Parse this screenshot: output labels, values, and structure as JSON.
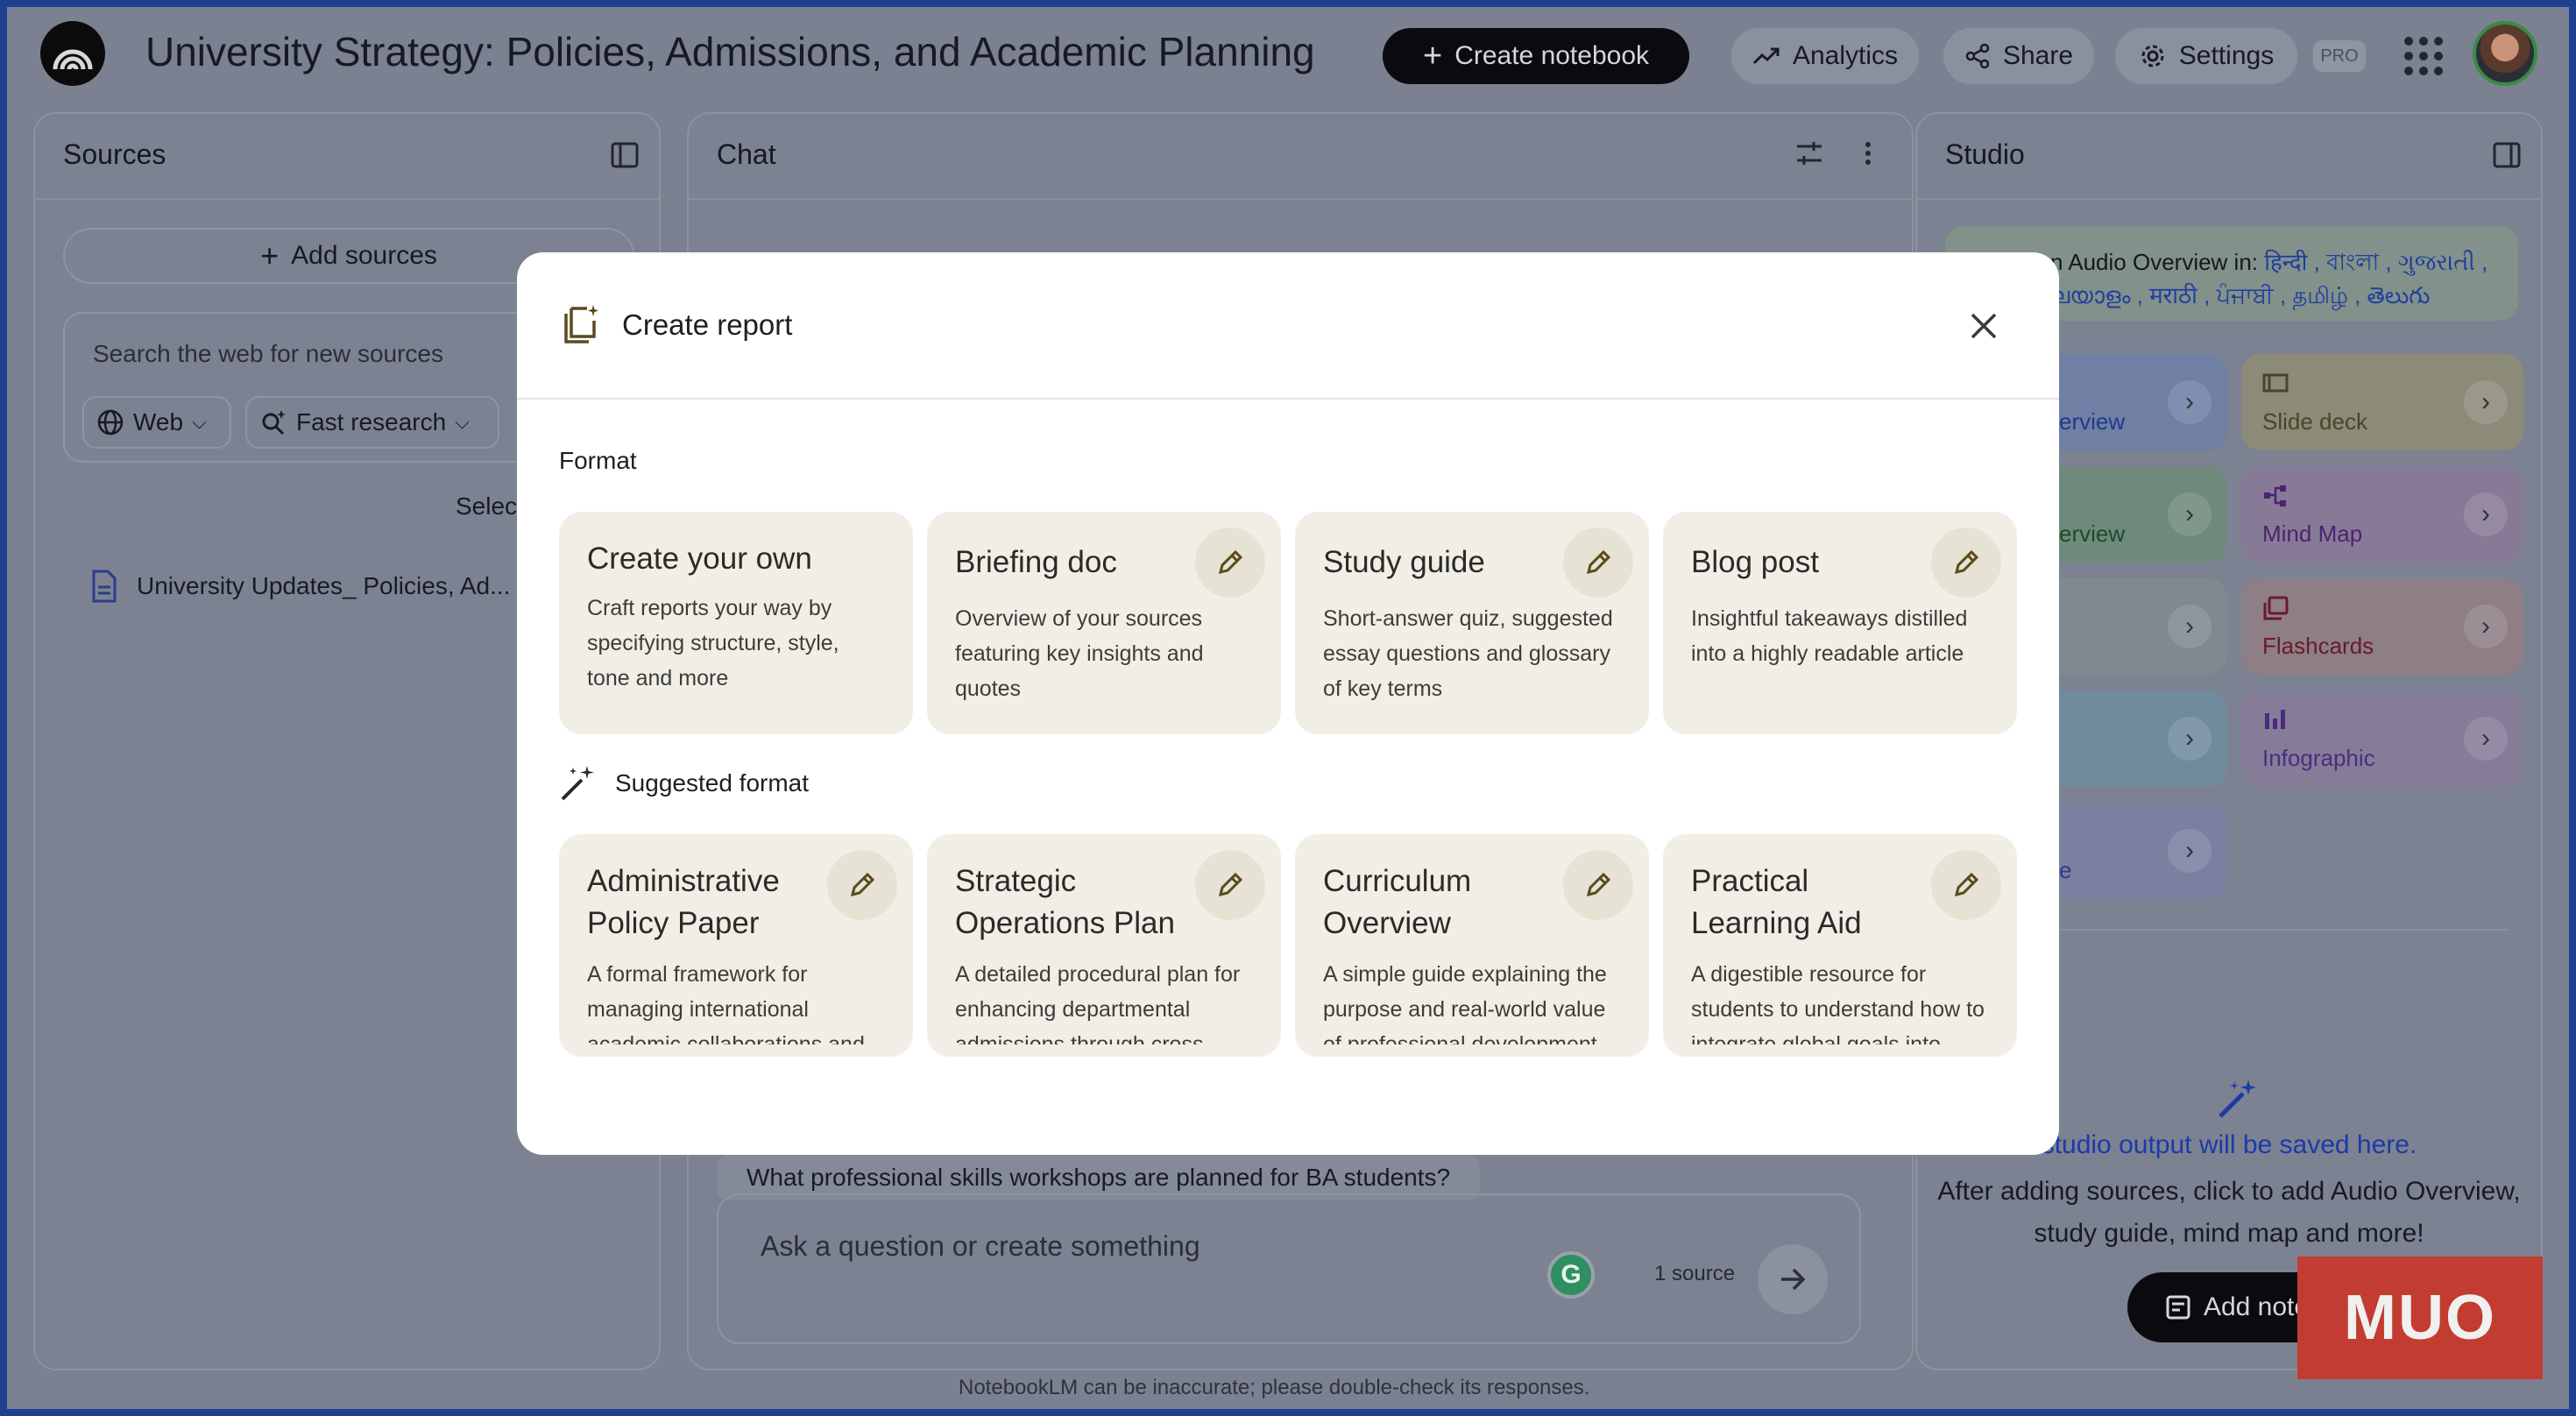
{
  "app": {
    "title": "University Strategy: Policies, Admissions, and Academic Planning",
    "create_notebook": "Create notebook",
    "analytics": "Analytics",
    "share": "Share",
    "settings": "Settings",
    "pro_badge": "PRO"
  },
  "sources": {
    "title": "Sources",
    "add_sources": "Add sources",
    "search_placeholder": "Search the web for new sources",
    "chip_web": "Web",
    "chip_research": "Fast research",
    "select_all": "Select",
    "items": [
      {
        "label": "University Updates_ Policies, Ad..."
      }
    ]
  },
  "chat": {
    "title": "Chat",
    "suggestion": "What professional skills workshops are planned for BA students?",
    "input_placeholder": "Ask a question or create something",
    "source_count": "1 source",
    "disclaimer": "NotebookLM can be inaccurate; please double-check its responses."
  },
  "studio": {
    "title": "Studio",
    "banner_prefix": "n Audio Overview in: ",
    "banner_langs_1": "हिन्दी , বাংলা , ગુજરાતી ,",
    "banner_langs_2": "ലയാളം , मराठी , ਪੰਜਾਬੀ , தமிழ் , తెలుగు",
    "tiles": [
      {
        "label": "erview",
        "color": "#6f80a4",
        "text_color": "#1f3a8c"
      },
      {
        "label": "Slide deck",
        "color": "#8c8a78",
        "text_color": "#4a4526"
      },
      {
        "label": "erview",
        "color": "#6f8a7c",
        "text_color": "#1d4a2a"
      },
      {
        "label": "Mind Map",
        "color": "#877a96",
        "text_color": "#4d2370"
      },
      {
        "label": "",
        "color": "#7e8a90",
        "text_color": "#1d2c46"
      },
      {
        "label": "Flashcards",
        "color": "#8e7f86",
        "text_color": "#6a1a2a"
      },
      {
        "label": "",
        "color": "#708b9c",
        "text_color": "#1d3a5c"
      },
      {
        "label": "Infographic",
        "color": "#857d98",
        "text_color": "#4a2c80"
      },
      {
        "label": "e",
        "color": "#7c80a0",
        "text_color": "#2c3a8e"
      }
    ],
    "saved_text": "studio output will be saved here.",
    "help_line_1": "After adding sources, click to add Audio Overview,",
    "help_line_2": "study guide, mind map and more!",
    "add_note": "Add note"
  },
  "watermark": "MUO",
  "modal": {
    "title": "Create report",
    "format_label": "Format",
    "suggested_label": "Suggested format",
    "formats": [
      {
        "title": "Create your own",
        "desc": "Craft reports your way by specifying structure, style, tone and more",
        "editable": false
      },
      {
        "title": "Briefing doc",
        "desc": "Overview of your sources featuring key insights and quotes",
        "editable": true
      },
      {
        "title": "Study guide",
        "desc": "Short-answer quiz, suggested essay questions and glossary of key terms",
        "editable": true
      },
      {
        "title": "Blog post",
        "desc": "Insightful takeaways distilled into a highly readable article",
        "editable": true
      }
    ],
    "suggested": [
      {
        "title": "Administrative Policy Paper",
        "desc": "A formal framework for managing international academic collaborations and..."
      },
      {
        "title": "Strategic Operations Plan",
        "desc": "A detailed procedural plan for enhancing departmental admissions through cross-..."
      },
      {
        "title": "Curriculum Overview",
        "desc": "A simple guide explaining the purpose and real-world value of professional development..."
      },
      {
        "title": "Practical Learning Aid",
        "desc": "A digestible resource for students to understand how to integrate global goals into..."
      }
    ]
  }
}
